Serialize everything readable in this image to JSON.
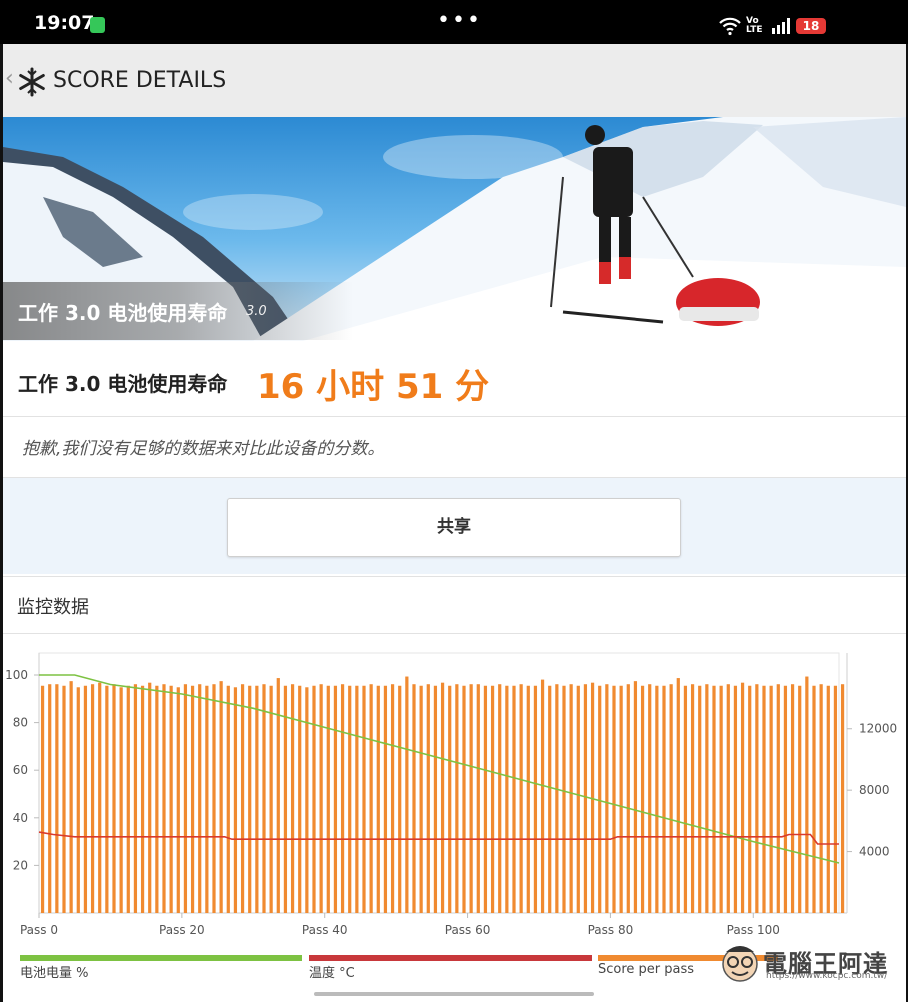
{
  "status_bar": {
    "time": "19:07",
    "network": "Vo LTE",
    "battery": "18"
  },
  "app_bar": {
    "title": "SCORE DETAILS",
    "back_icon": "chevron-left-icon",
    "logo_icon": "snowflake-icon"
  },
  "hero": {
    "caption": "工作 3.0 电池使用寿命",
    "version": "3.0"
  },
  "score": {
    "label": "工作 3.0 电池使用寿命",
    "value": "16 小时 51 分"
  },
  "note": "抱歉,我们没有足够的数据来对比此设备的分数。",
  "share_label": "共享",
  "monitoring": {
    "title": "监控数据"
  },
  "colors": {
    "accent": "#f07c1a",
    "battery_series": "#7dc242",
    "temperature_series": "#d93a2b",
    "score_series": "#f08a30"
  },
  "chart_data": {
    "type": "bar",
    "x_tick_labels": [
      "Pass 0",
      "Pass 20",
      "Pass 40",
      "Pass 60",
      "Pass 80",
      "Pass 100"
    ],
    "x_ticks": [
      0,
      20,
      40,
      60,
      80,
      100
    ],
    "xlim": [
      0,
      112
    ],
    "left_axis": {
      "ticks": [
        "100",
        "80",
        "60",
        "40",
        "20"
      ],
      "ylim": [
        0,
        100
      ]
    },
    "right_axis": {
      "ticks": [
        "12000",
        "8000",
        "4000"
      ],
      "ylim": [
        0,
        15500
      ]
    },
    "series": [
      {
        "name": "电池电量 %",
        "type": "line",
        "axis": "left",
        "points": [
          [
            0,
            100
          ],
          [
            5,
            100
          ],
          [
            10,
            96
          ],
          [
            20,
            92
          ],
          [
            30,
            86
          ],
          [
            40,
            78
          ],
          [
            50,
            70
          ],
          [
            60,
            62
          ],
          [
            70,
            54
          ],
          [
            80,
            46
          ],
          [
            90,
            38
          ],
          [
            100,
            30
          ],
          [
            108,
            24
          ],
          [
            112,
            21
          ]
        ]
      },
      {
        "name": "温度 °C",
        "type": "line",
        "axis": "left",
        "points": [
          [
            0,
            34
          ],
          [
            2,
            33
          ],
          [
            5,
            32
          ],
          [
            26,
            32
          ],
          [
            27,
            31
          ],
          [
            80,
            31
          ],
          [
            81,
            32
          ],
          [
            104,
            32
          ],
          [
            105,
            33
          ],
          [
            108,
            33
          ],
          [
            109,
            29
          ],
          [
            112,
            29
          ]
        ]
      },
      {
        "name": "Score per pass",
        "type": "bar",
        "axis": "right",
        "values": [
          14800,
          14900,
          14900,
          14800,
          15100,
          14700,
          14800,
          14900,
          15000,
          14800,
          14900,
          14700,
          14800,
          14900,
          14800,
          15000,
          14800,
          14900,
          14800,
          14700,
          14900,
          14800,
          14900,
          14800,
          14900,
          15100,
          14800,
          14700,
          14900,
          14800,
          14800,
          14900,
          14800,
          15300,
          14800,
          14900,
          14800,
          14700,
          14800,
          14900,
          14800,
          14800,
          14900,
          14800,
          14800,
          14800,
          14900,
          14800,
          14800,
          14900,
          14800,
          15400,
          14900,
          14800,
          14900,
          14800,
          15000,
          14800,
          14900,
          14800,
          14900,
          14900,
          14800,
          14800,
          14900,
          14800,
          14800,
          14900,
          14800,
          14800,
          15200,
          14800,
          14900,
          14800,
          14900,
          14800,
          14900,
          15000,
          14800,
          14900,
          14800,
          14800,
          14900,
          15100,
          14800,
          14900,
          14800,
          14800,
          14900,
          15300,
          14800,
          14900,
          14800,
          14900,
          14800,
          14800,
          14900,
          14800,
          15000,
          14800,
          14900,
          14800,
          14800,
          14900,
          14800,
          14900,
          14800,
          15400,
          14800,
          14900,
          14800,
          14800,
          14900
        ]
      }
    ],
    "legend_placement": "bottom"
  },
  "watermark": {
    "text": "電腦王阿達",
    "url": "https://www.kocpc.com.tw/"
  }
}
